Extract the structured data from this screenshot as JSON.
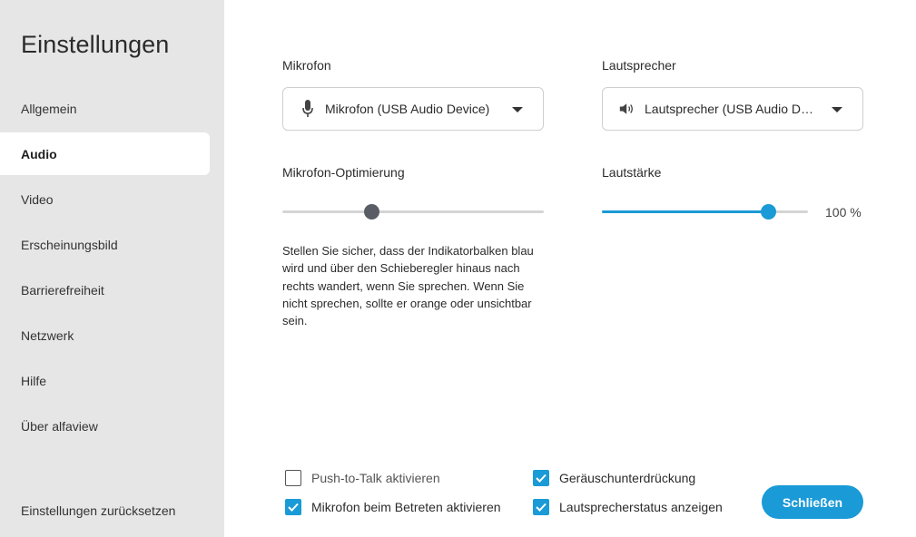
{
  "sidebar": {
    "title": "Einstellungen",
    "items": [
      {
        "label": "Allgemein",
        "active": false
      },
      {
        "label": "Audio",
        "active": true
      },
      {
        "label": "Video",
        "active": false
      },
      {
        "label": "Erscheinungsbild",
        "active": false
      },
      {
        "label": "Barrierefreiheit",
        "active": false
      },
      {
        "label": "Netzwerk",
        "active": false
      },
      {
        "label": "Hilfe",
        "active": false
      },
      {
        "label": "Über alfaview",
        "active": false
      }
    ],
    "reset_label": "Einstellungen zurücksetzen"
  },
  "microphone": {
    "label": "Mikrofon",
    "selected": "Mikrofon (USB Audio Device)",
    "icon": "microphone-icon"
  },
  "speaker": {
    "label": "Lautsprecher",
    "selected": "Lautsprecher (USB Audio Dev...",
    "icon": "speaker-icon"
  },
  "mic_optimization": {
    "label": "Mikrofon-Optimierung",
    "level": 0.34,
    "help_text": "Stellen Sie sicher, dass der Indikatorbalken blau wird und über den Schieberegler hinaus nach rechts wandert, wenn Sie sprechen. Wenn Sie nicht sprechen, sollte er orange oder unsichtbar sein."
  },
  "volume": {
    "label": "Lautstärke",
    "level": 1.0,
    "value_text": "100 %"
  },
  "options": {
    "push_to_talk": {
      "label": "Push-to-Talk aktivieren",
      "checked": false
    },
    "mic_on_join": {
      "label": "Mikrofon beim Betreten aktivieren",
      "checked": true
    },
    "noise_suppression": {
      "label": "Geräuschunterdrückung",
      "checked": true
    },
    "speaker_status": {
      "label": "Lautsprecherstatus anzeigen",
      "checked": true
    }
  },
  "close_label": "Schließen",
  "colors": {
    "accent": "#1a9ad6",
    "sidebar_bg": "#e6e6e6",
    "thumb_gray": "#5a5c66"
  }
}
